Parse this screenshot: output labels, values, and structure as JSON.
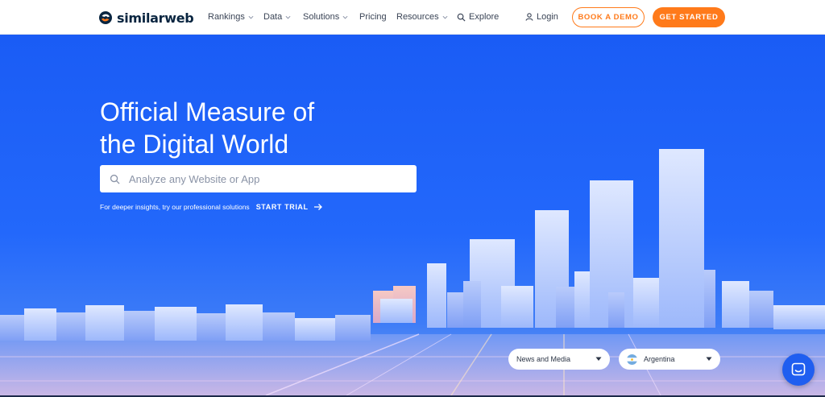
{
  "header": {
    "brand": "similarweb",
    "nav": [
      {
        "label": "Rankings",
        "dropdown": true
      },
      {
        "label": "Data",
        "dropdown": true
      },
      {
        "label": "Solutions",
        "dropdown": true
      },
      {
        "label": "Pricing",
        "dropdown": false
      },
      {
        "label": "Resources",
        "dropdown": true
      }
    ],
    "explore_label": "Explore",
    "login_label": "Login",
    "demo_label": "BOOK A DEMO",
    "start_label": "GET STARTED"
  },
  "hero": {
    "title_line1": "Official Measure of",
    "title_line2": "the Digital World",
    "search_placeholder": "Analyze any Website or App",
    "insights_text": "For deeper insights, try our professional solutions",
    "trial_label": "START TRIAL"
  },
  "filters": {
    "category": "News and Media",
    "country": "Argentina"
  },
  "icons": {
    "search": "search-icon",
    "user": "user-icon",
    "arrow": "arrow-right-icon",
    "chat": "chat-icon",
    "flag": "argentina-flag-icon"
  },
  "colors": {
    "brand_orange": "#ff7a1a",
    "hero_blue": "#1a5cf5",
    "text_dark": "#092540"
  }
}
